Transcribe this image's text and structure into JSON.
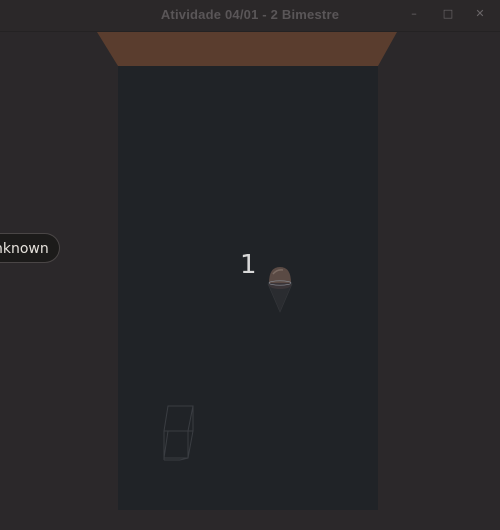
{
  "window": {
    "title": "Atividade 04/01 - 2 Bimestre",
    "minimize_glyph": "–",
    "maximize_glyph": "□",
    "close_glyph": "✕"
  },
  "hud": {
    "score": "1",
    "badge": "nknown"
  },
  "colors": {
    "background": "#2b282a",
    "floor": "#202327",
    "back_wall": "#5a3d2e",
    "player": "#5a4a44"
  },
  "icons": {
    "player": "ice-cream-cone-icon",
    "obstacle": "wireframe-box-icon"
  }
}
